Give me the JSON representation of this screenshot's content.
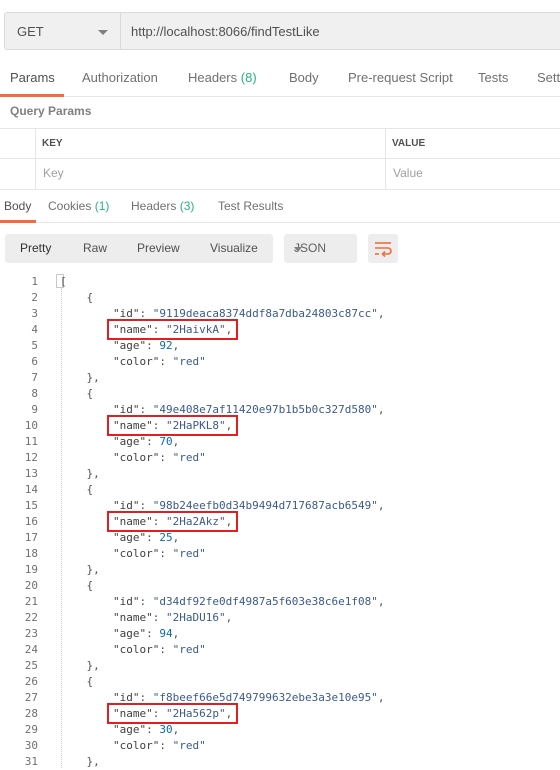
{
  "request": {
    "method": "GET",
    "url": "http://localhost:8066/findTestLike"
  },
  "request_tabs": {
    "params": "Params",
    "authorization": "Authorization",
    "headers": "Headers",
    "headers_count": "(8)",
    "body": "Body",
    "prerequest": "Pre-request Script",
    "tests": "Tests",
    "settings": "Sett"
  },
  "query_params": {
    "title": "Query Params",
    "key_header": "KEY",
    "value_header": "VALUE",
    "key_placeholder": "Key",
    "value_placeholder": "Value"
  },
  "response_tabs": {
    "body": "Body",
    "cookies": "Cookies",
    "cookies_count": "(1)",
    "headers": "Headers",
    "headers_count": "(3)",
    "test_results": "Test Results"
  },
  "view_modes": {
    "pretty": "Pretty",
    "raw": "Raw",
    "preview": "Preview",
    "visualize": "Visualize",
    "language": "JSON"
  },
  "code_lines": [
    "[",
    "    {",
    "        \"id\": \"9119deaca8374ddf8a7dba24803c87cc\",",
    "        \"name\": \"2HaivkA\",",
    "        \"age\": 92,",
    "        \"color\": \"red\"",
    "    },",
    "    {",
    "        \"id\": \"49e408e7af11420e97b1b5b0c327d580\",",
    "        \"name\": \"2HaPKL8\",",
    "        \"age\": 70,",
    "        \"color\": \"red\"",
    "    },",
    "    {",
    "        \"id\": \"98b24eefb0d34b9494d717687acb6549\",",
    "        \"name\": \"2Ha2Akz\",",
    "        \"age\": 25,",
    "        \"color\": \"red\"",
    "    },",
    "    {",
    "        \"id\": \"d34df92fe0df4987a5f603e38c6e1f08\",",
    "        \"name\": \"2HaDU16\",",
    "        \"age\": 94,",
    "        \"color\": \"red\"",
    "    },",
    "    {",
    "        \"id\": \"f8beef66e5d749799632ebe3a3e10e95\",",
    "        \"name\": \"2Ha562p\",",
    "        \"age\": 30,",
    "        \"color\": \"red\"",
    "    },"
  ],
  "highlighted_lines": [
    4,
    10,
    16,
    28
  ],
  "colors": {
    "accent": "#f26b3a",
    "count_green": "#26b47f",
    "highlight_red": "#e02020"
  }
}
